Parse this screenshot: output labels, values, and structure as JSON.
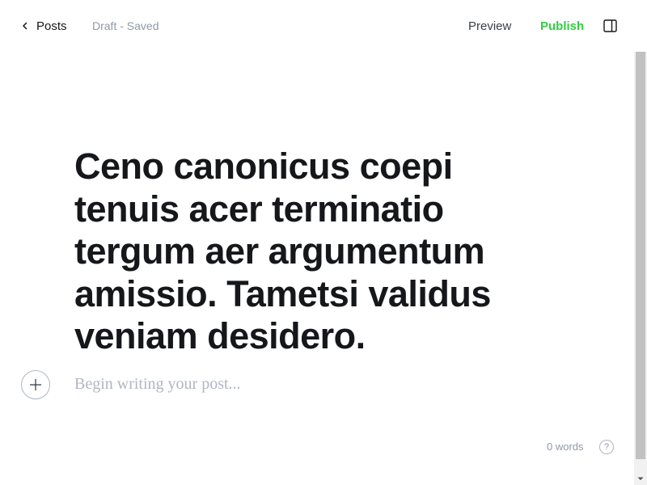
{
  "header": {
    "back_label": "Posts",
    "back_icon": "chevron-left-icon",
    "status": "Draft - Saved",
    "preview_label": "Preview",
    "publish_label": "Publish",
    "sidebar_icon": "sidebar-toggle-icon"
  },
  "editor": {
    "title": "Ceno canonicus coepi tenuis acer terminatio tergum aer argumentum amissio. Tametsi validus veniam desidero.",
    "body_placeholder": "Begin writing your post...",
    "add_card_icon": "plus-icon"
  },
  "footer": {
    "word_count": "0 words",
    "help_symbol": "?"
  },
  "colors": {
    "accent": "#30cf43",
    "text": "#15171a",
    "muted": "#8e9aa7",
    "placeholder": "#aeb7c1"
  }
}
